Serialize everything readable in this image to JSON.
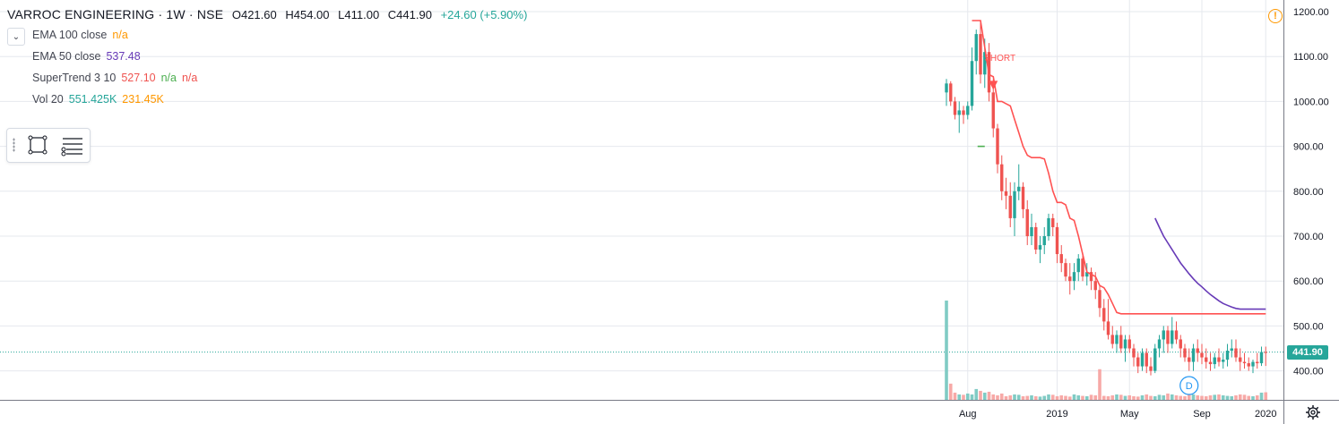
{
  "header": {
    "symbol": "VARROC ENGINEERING · 1W · NSE",
    "open": "O421.60",
    "high": "H454.00",
    "low": "L411.00",
    "close": "C441.90",
    "change": "+24.60 (+5.90%)"
  },
  "legend": [
    {
      "name": "EMA 100 close",
      "values": [
        {
          "text": "n/a",
          "color": "#ff9800"
        }
      ]
    },
    {
      "name": "EMA 50 close",
      "values": [
        {
          "text": "537.48",
          "color": "#673ab7"
        }
      ]
    },
    {
      "name": "SuperTrend 3 10",
      "values": [
        {
          "text": "527.10",
          "color": "#ef5350"
        },
        {
          "text": "n/a",
          "color": "#4caf50"
        },
        {
          "text": "n/a",
          "color": "#ef5350"
        }
      ]
    },
    {
      "name": "Vol 20",
      "values": [
        {
          "text": "551.425K",
          "color": "#26a69a"
        },
        {
          "text": "231.45K",
          "color": "#ff9800"
        }
      ]
    }
  ],
  "last_price_label": "441.90",
  "colors": {
    "up": "#26a69a",
    "down": "#ef5350",
    "supertrend": "#ff5252",
    "ema50": "#673ab7",
    "vol_up": "#80cbc4",
    "vol_down": "#f7a9a7"
  },
  "icons": [
    "chevron-down-icon",
    "rectangle-icon",
    "lines-icon",
    "warning-icon",
    "gear-icon"
  ],
  "chart_data": {
    "type": "candlestick",
    "title": "VARROC ENGINEERING · 1W · NSE",
    "y_ticks": [
      "1200.00",
      "1100.00",
      "1000.00",
      "900.00",
      "800.00",
      "700.00",
      "600.00",
      "500.00",
      "400.00"
    ],
    "ylim": [
      330,
      1225
    ],
    "x_ticks": [
      "Aug",
      "2019",
      "May",
      "Sep",
      "2020"
    ],
    "x_tick_weeks": [
      5,
      26,
      43,
      60,
      75
    ],
    "week_count": 76,
    "grid": true,
    "event_marker": "D",
    "event_marker_week": 57,
    "signal_label": "SHORT",
    "signal_week": 11,
    "candles": [
      [
        1020,
        1050,
        990,
        1040
      ],
      [
        1040,
        1045,
        990,
        1000
      ],
      [
        1000,
        1010,
        960,
        970
      ],
      [
        970,
        1000,
        930,
        980
      ],
      [
        980,
        990,
        950,
        970
      ],
      [
        970,
        1000,
        960,
        990
      ],
      [
        990,
        1120,
        980,
        1090
      ],
      [
        1090,
        1160,
        1060,
        1150
      ],
      [
        1150,
        1180,
        1040,
        1060
      ],
      [
        1060,
        1140,
        1030,
        1110
      ],
      [
        1110,
        1130,
        1000,
        1020
      ],
      [
        1020,
        1050,
        920,
        940
      ],
      [
        940,
        950,
        840,
        860
      ],
      [
        860,
        880,
        780,
        800
      ],
      [
        800,
        830,
        760,
        790
      ],
      [
        790,
        820,
        720,
        740
      ],
      [
        740,
        820,
        700,
        800
      ],
      [
        800,
        860,
        780,
        810
      ],
      [
        810,
        820,
        740,
        760
      ],
      [
        760,
        780,
        680,
        700
      ],
      [
        700,
        750,
        680,
        720
      ],
      [
        720,
        730,
        660,
        670
      ],
      [
        670,
        700,
        640,
        680
      ],
      [
        680,
        720,
        660,
        700
      ],
      [
        700,
        750,
        690,
        740
      ],
      [
        740,
        750,
        700,
        720
      ],
      [
        720,
        730,
        640,
        660
      ],
      [
        660,
        680,
        620,
        640
      ],
      [
        640,
        650,
        600,
        610
      ],
      [
        610,
        640,
        570,
        600
      ],
      [
        600,
        640,
        580,
        620
      ],
      [
        620,
        660,
        600,
        650
      ],
      [
        650,
        660,
        600,
        610
      ],
      [
        610,
        640,
        590,
        620
      ],
      [
        620,
        630,
        580,
        600
      ],
      [
        600,
        620,
        560,
        580
      ],
      [
        580,
        590,
        520,
        540
      ],
      [
        540,
        560,
        490,
        510
      ],
      [
        510,
        560,
        470,
        480
      ],
      [
        480,
        500,
        450,
        460
      ],
      [
        460,
        490,
        440,
        480
      ],
      [
        480,
        500,
        440,
        450
      ],
      [
        450,
        480,
        420,
        470
      ],
      [
        470,
        480,
        440,
        450
      ],
      [
        450,
        460,
        410,
        430
      ],
      [
        430,
        440,
        395,
        410
      ],
      [
        410,
        450,
        400,
        440
      ],
      [
        440,
        450,
        395,
        410
      ],
      [
        410,
        430,
        390,
        400
      ],
      [
        400,
        460,
        395,
        450
      ],
      [
        450,
        480,
        430,
        470
      ],
      [
        470,
        500,
        440,
        490
      ],
      [
        490,
        500,
        440,
        460
      ],
      [
        460,
        520,
        450,
        490
      ],
      [
        490,
        510,
        460,
        470
      ],
      [
        470,
        480,
        430,
        450
      ],
      [
        450,
        460,
        420,
        430
      ],
      [
        430,
        450,
        400,
        420
      ],
      [
        420,
        460,
        400,
        450
      ],
      [
        450,
        470,
        420,
        440
      ],
      [
        440,
        460,
        415,
        430
      ],
      [
        430,
        450,
        405,
        420
      ],
      [
        420,
        440,
        400,
        415
      ],
      [
        415,
        440,
        405,
        430
      ],
      [
        430,
        450,
        410,
        420
      ],
      [
        420,
        440,
        405,
        425
      ],
      [
        425,
        460,
        410,
        445
      ],
      [
        445,
        470,
        430,
        450
      ],
      [
        450,
        470,
        420,
        430
      ],
      [
        430,
        450,
        400,
        420
      ],
      [
        420,
        440,
        405,
        417
      ],
      [
        417,
        430,
        400,
        410
      ],
      [
        410,
        425,
        395,
        420
      ],
      [
        420,
        440,
        405,
        417
      ],
      [
        417,
        454,
        411,
        442
      ],
      [
        442,
        454,
        411,
        441.9
      ]
    ],
    "volume_bars": [
      551,
      90,
      40,
      30,
      28,
      35,
      30,
      60,
      50,
      40,
      45,
      30,
      25,
      35,
      20,
      25,
      30,
      28,
      20,
      22,
      25,
      20,
      18,
      22,
      30,
      28,
      20,
      25,
      22,
      18,
      30,
      25,
      22,
      20,
      28,
      25,
      170,
      22,
      20,
      25,
      30,
      28,
      22,
      25,
      20,
      18,
      25,
      30,
      22,
      20,
      28,
      25,
      35,
      30,
      25,
      22,
      20,
      28,
      30,
      25,
      22,
      20,
      25,
      28,
      30,
      25,
      22,
      20,
      25,
      30,
      28,
      22,
      20,
      25,
      40,
      42
    ],
    "supertrend": [
      null,
      null,
      null,
      null,
      null,
      null,
      1180,
      1180,
      1180,
      1120,
      1060,
      1055,
      1000,
      1000,
      995,
      990,
      960,
      930,
      900,
      880,
      875,
      875,
      875,
      872,
      840,
      800,
      775,
      775,
      770,
      740,
      735,
      700,
      660,
      620,
      615,
      610,
      590,
      585,
      570,
      550,
      530,
      527.1,
      527.1,
      527.1,
      527.1,
      527.1,
      527.1,
      527.1,
      527.1,
      527.1,
      527.1,
      527.1,
      527.1,
      527.1,
      527.1,
      527.1,
      527.1,
      527.1,
      527.1,
      527.1,
      527.1,
      527.1,
      527.1,
      527.1,
      527.1,
      527.1,
      527.1,
      527.1,
      527.1,
      527.1,
      527.1,
      527.1,
      527.1,
      527.1,
      527.1,
      527.1
    ],
    "ema50": [
      null,
      null,
      null,
      null,
      null,
      null,
      null,
      null,
      null,
      null,
      null,
      null,
      null,
      null,
      null,
      null,
      null,
      null,
      null,
      null,
      null,
      null,
      null,
      null,
      null,
      null,
      null,
      null,
      null,
      null,
      null,
      null,
      null,
      null,
      null,
      null,
      null,
      null,
      null,
      null,
      null,
      null,
      null,
      null,
      null,
      null,
      null,
      null,
      null,
      740,
      720,
      700,
      685,
      670,
      655,
      640,
      628,
      616,
      605,
      595,
      587,
      578,
      570,
      563,
      556,
      550,
      546,
      542,
      539,
      537.48,
      537.48,
      537.48,
      537.48,
      537.48,
      537.48,
      537.48
    ]
  }
}
